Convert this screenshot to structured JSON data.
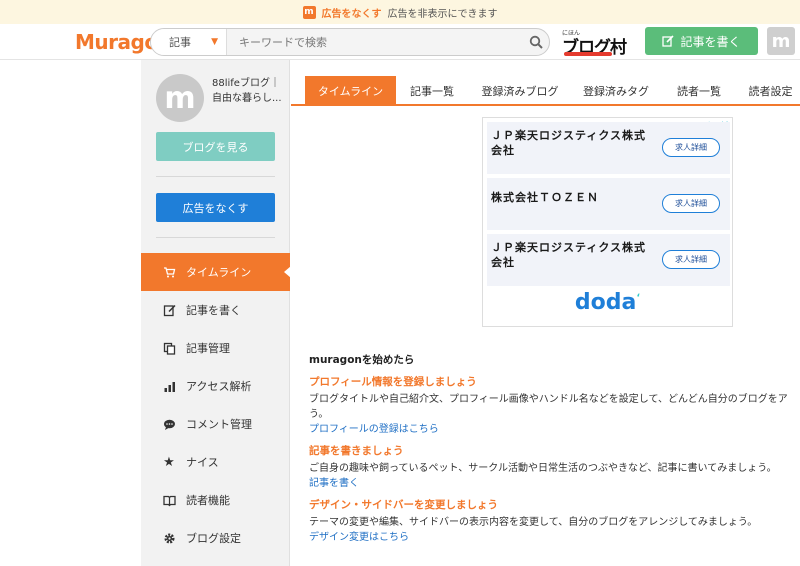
{
  "ad_banner": {
    "icon_letter": "m",
    "link": "広告をなくす",
    "text": "広告を非表示にできます"
  },
  "header": {
    "logo": "Muragon",
    "search": {
      "category": "記事",
      "placeholder": "キーワードで検索"
    },
    "blogmura": {
      "small": "にほん",
      "big": "ブログ村"
    },
    "write_button": "記事を書く",
    "avatar_letter": "m"
  },
  "sidebar": {
    "avatar_letter": "m",
    "blog_name": "88lifeブログ｜自由な暮らし...",
    "view_blog_button": "ブログを見る",
    "remove_ads_button": "広告をなくす",
    "items": [
      {
        "label": "タイムライン",
        "icon": "cart-icon",
        "active": true
      },
      {
        "label": "記事を書く",
        "icon": "edit-icon",
        "active": false
      },
      {
        "label": "記事管理",
        "icon": "copy-icon",
        "active": false
      },
      {
        "label": "アクセス解析",
        "icon": "bar-chart-icon",
        "active": false
      },
      {
        "label": "コメント管理",
        "icon": "comment-icon",
        "active": false
      },
      {
        "label": "ナイス",
        "icon": "star-icon",
        "active": false
      },
      {
        "label": "読者機能",
        "icon": "book-icon",
        "active": false
      },
      {
        "label": "ブログ設定",
        "icon": "gear-icon",
        "active": false
      }
    ]
  },
  "tabs": [
    {
      "label": "タイムライン",
      "active": true
    },
    {
      "label": "記事一覧",
      "active": false
    },
    {
      "label": "登録済みブログ",
      "active": false
    },
    {
      "label": "登録済みタグ",
      "active": false
    },
    {
      "label": "読者一覧",
      "active": false
    },
    {
      "label": "読者設定",
      "active": false
    }
  ],
  "ad": {
    "rows": [
      {
        "company": "ＪＰ楽天ロジスティクス株式会社",
        "button": "求人詳細"
      },
      {
        "company": "株式会社ＴＯＺＥＮ",
        "button": "求人詳細"
      },
      {
        "company": "ＪＰ楽天ロジスティクス株式会社",
        "button": "求人詳細"
      }
    ],
    "brand": "doda"
  },
  "guide": {
    "heading": "muragonを始めたら",
    "sections": [
      {
        "title": "プロフィール情報を登録しましょう",
        "desc": "ブログタイトルや自己紹介文、プロフィール画像やハンドル名などを設定して、どんどん自分のブログをア",
        "desc2": "う。",
        "link": "プロフィールの登録はこちら"
      },
      {
        "title": "記事を書きましょう",
        "desc": "ご自身の趣味や飼っているペット、サークル活動や日常生活のつぶやきなど、記事に書いてみましょう。",
        "desc2": "",
        "link": "記事を書く"
      },
      {
        "title": "デザイン・サイドバーを変更しましょう",
        "desc": "テーマの変更や編集、サイドバーの表示内容を変更して、自分のブログをアレンジしてみましょう。",
        "desc2": "",
        "link": "デザイン変更はこちら"
      }
    ]
  },
  "colors": {
    "accent": "#f2782c",
    "primary_blue": "#1f7fd8",
    "teal": "#7fcdc2",
    "green": "#5bbd7a"
  }
}
